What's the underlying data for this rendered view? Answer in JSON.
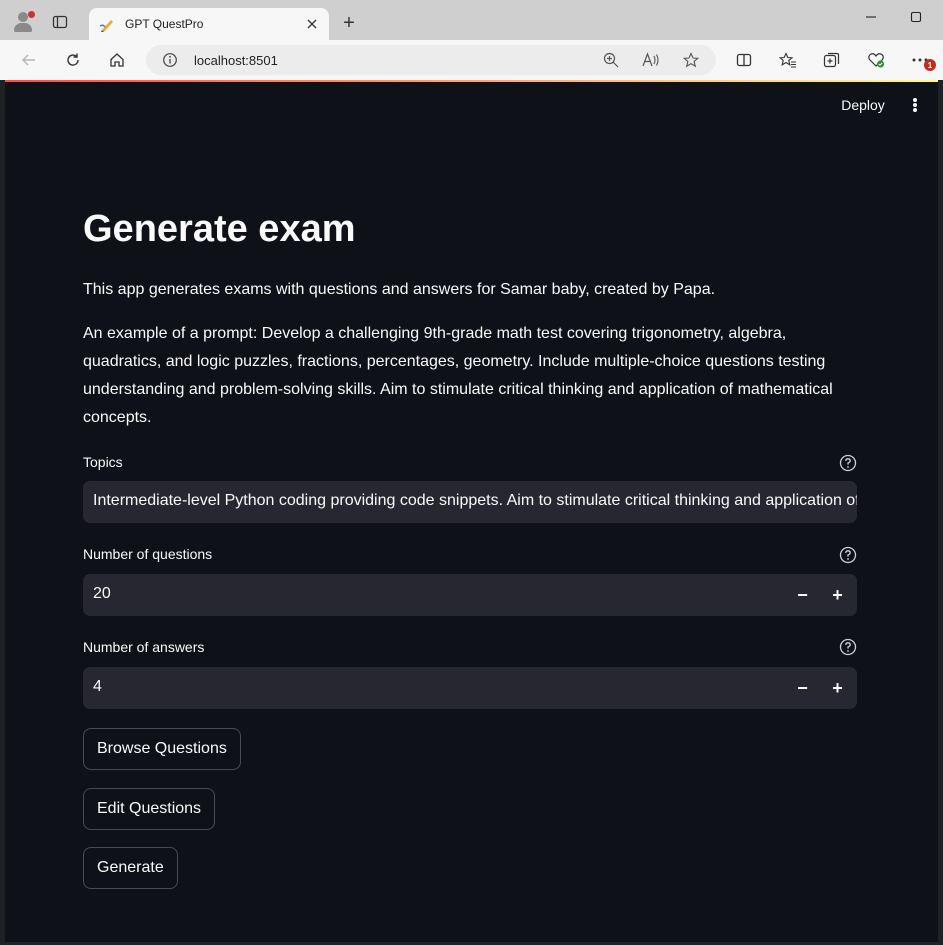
{
  "browser": {
    "tab_title": "GPT QuestPro",
    "url": "localhost:8501",
    "new_tab_symbol": "+",
    "notification_count": "1"
  },
  "app": {
    "header": {
      "deploy_label": "Deploy"
    },
    "title": "Generate exam",
    "intro": "This app generates exams with questions and answers for Samar baby, created by Papa.",
    "example_prompt": "An example of a prompt: Develop a challenging 9th-grade math test covering trigonometry, algebra, quadratics, and logic puzzles, fractions, percentages, geometry. Include multiple-choice questions testing understanding and problem-solving skills. Aim to stimulate critical thinking and application of mathematical concepts.",
    "topics": {
      "label": "Topics",
      "value": "Intermediate-level Python coding providing code snippets. Aim to stimulate critical thinking and application of Python concepts."
    },
    "num_questions": {
      "label": "Number of questions",
      "value": "20"
    },
    "num_answers": {
      "label": "Number of answers",
      "value": "4"
    },
    "buttons": {
      "browse": "Browse Questions",
      "edit": "Edit Questions",
      "generate": "Generate"
    },
    "stepper": {
      "minus": "−",
      "plus": "+"
    }
  },
  "colors": {
    "app_background": "#0e1117",
    "input_background": "#262730",
    "text": "#fafafa",
    "accent_red": "#ff4b4b"
  },
  "icons": [
    "profile-icon",
    "tab-actions-icon",
    "close-icon",
    "back-icon",
    "reload-icon",
    "home-icon",
    "site-info-icon",
    "zoom-icon",
    "read-aloud-icon",
    "favorite-star-icon",
    "split-screen-icon",
    "favorites-icon",
    "collections-icon",
    "browser-essentials-icon",
    "more-icon",
    "help-icon"
  ]
}
